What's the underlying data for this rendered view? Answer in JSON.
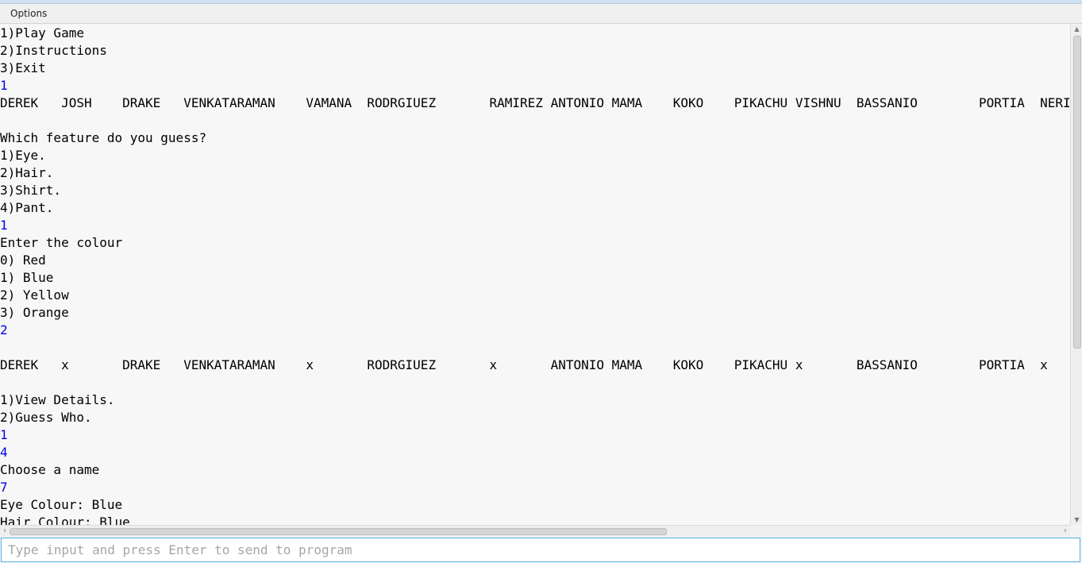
{
  "menubar": {
    "options_label": "Options"
  },
  "console": {
    "lines": [
      {
        "text": "1)Play Game",
        "type": "output"
      },
      {
        "text": "2)Instructions",
        "type": "output"
      },
      {
        "text": "3)Exit",
        "type": "output"
      },
      {
        "text": "1",
        "type": "input"
      },
      {
        "text": "DEREK   JOSH    DRAKE   VENKATARAMAN    VAMANA  RODRGIUEZ       RAMIREZ ANTONIO MAMA    KOKO    PIKACHU VISHNU  BASSANIO        PORTIA  NERISSA",
        "type": "output"
      },
      {
        "text": "",
        "type": "output"
      },
      {
        "text": "Which feature do you guess?",
        "type": "output"
      },
      {
        "text": "1)Eye.",
        "type": "output"
      },
      {
        "text": "2)Hair.",
        "type": "output"
      },
      {
        "text": "3)Shirt.",
        "type": "output"
      },
      {
        "text": "4)Pant.",
        "type": "output"
      },
      {
        "text": "1",
        "type": "input"
      },
      {
        "text": "Enter the colour",
        "type": "output"
      },
      {
        "text": "0) Red",
        "type": "output"
      },
      {
        "text": "1) Blue",
        "type": "output"
      },
      {
        "text": "2) Yellow",
        "type": "output"
      },
      {
        "text": "3) Orange",
        "type": "output"
      },
      {
        "text": "2",
        "type": "input"
      },
      {
        "text": "",
        "type": "output"
      },
      {
        "text": "DEREK   x       DRAKE   VENKATARAMAN    x       RODRGIUEZ       x       ANTONIO MAMA    KOKO    PIKACHU x       BASSANIO        PORTIA  x",
        "type": "output"
      },
      {
        "text": "",
        "type": "output"
      },
      {
        "text": "1)View Details.",
        "type": "output"
      },
      {
        "text": "2)Guess Who.",
        "type": "output"
      },
      {
        "text": "1",
        "type": "input"
      },
      {
        "text": "4",
        "type": "input"
      },
      {
        "text": "Choose a name",
        "type": "output"
      },
      {
        "text": "7",
        "type": "input"
      },
      {
        "text": "Eye Colour: Blue",
        "type": "output"
      },
      {
        "text": "Hair Colour: Blue",
        "type": "output"
      }
    ]
  },
  "input": {
    "placeholder": "Type input and press Enter to send to program",
    "value": ""
  },
  "colors": {
    "echo_input": "#0000ee",
    "output_text": "#000000",
    "input_focus_border": "#56b0e6"
  }
}
